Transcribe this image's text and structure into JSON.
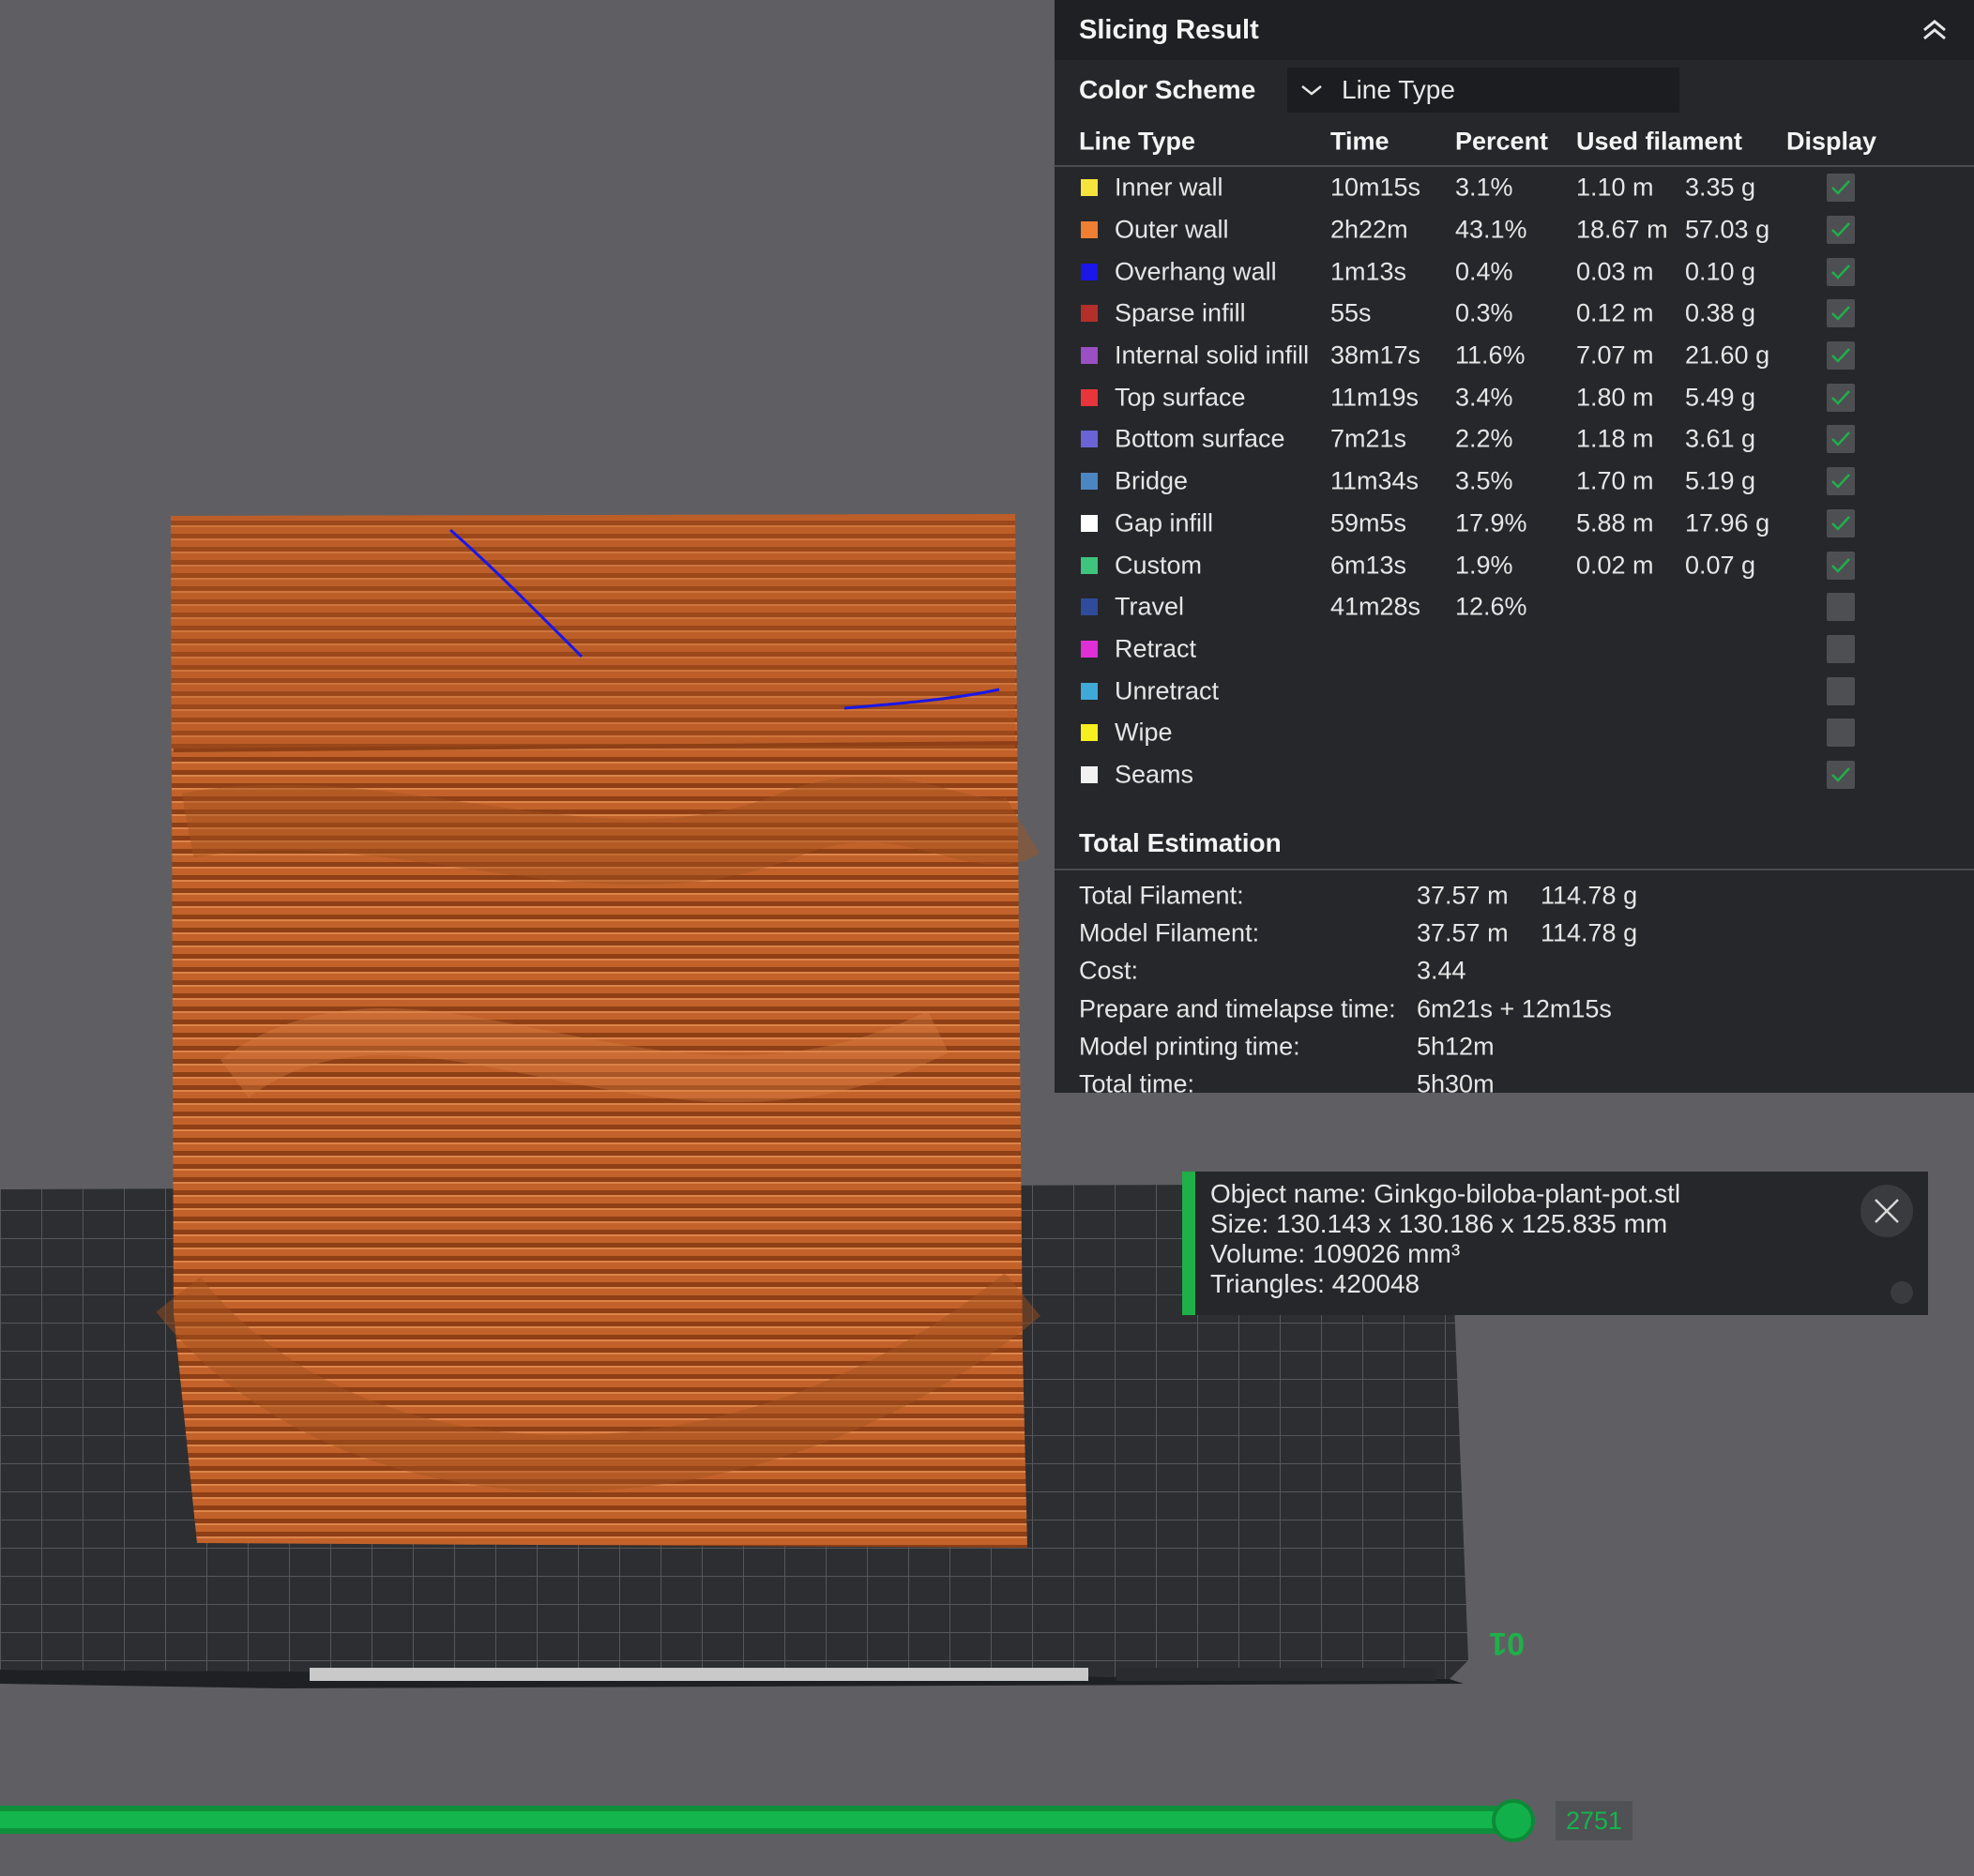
{
  "panel": {
    "title": "Slicing Result",
    "color_scheme_label": "Color Scheme",
    "color_scheme_value": "Line Type",
    "columns": {
      "type": "Line Type",
      "time": "Time",
      "percent": "Percent",
      "used": "Used filament",
      "display": "Display"
    },
    "rows": [
      {
        "name": "Inner wall",
        "color": "#f6e33d",
        "time": "10m15s",
        "percent": "3.1%",
        "length": "1.10 m",
        "weight": "3.35 g",
        "display": true
      },
      {
        "name": "Outer wall",
        "color": "#f07f32",
        "time": "2h22m",
        "percent": "43.1%",
        "length": "18.67 m",
        "weight": "57.03 g",
        "display": true
      },
      {
        "name": "Overhang wall",
        "color": "#1a17e8",
        "time": "1m13s",
        "percent": "0.4%",
        "length": "0.03 m",
        "weight": "0.10 g",
        "display": true
      },
      {
        "name": "Sparse infill",
        "color": "#b52f2a",
        "time": "55s",
        "percent": "0.3%",
        "length": "0.12 m",
        "weight": "0.38 g",
        "display": true
      },
      {
        "name": "Internal solid infill",
        "color": "#9a4fc2",
        "time": "38m17s",
        "percent": "11.6%",
        "length": "7.07 m",
        "weight": "21.60 g",
        "display": true
      },
      {
        "name": "Top surface",
        "color": "#e8353a",
        "time": "11m19s",
        "percent": "3.4%",
        "length": "1.80 m",
        "weight": "5.49 g",
        "display": true
      },
      {
        "name": "Bottom surface",
        "color": "#6a63d6",
        "time": "7m21s",
        "percent": "2.2%",
        "length": "1.18 m",
        "weight": "3.61 g",
        "display": true
      },
      {
        "name": "Bridge",
        "color": "#4c86c2",
        "time": "11m34s",
        "percent": "3.5%",
        "length": "1.70 m",
        "weight": "5.19 g",
        "display": true
      },
      {
        "name": "Gap infill",
        "color": "#ffffff",
        "time": "59m5s",
        "percent": "17.9%",
        "length": "5.88 m",
        "weight": "17.96 g",
        "display": true
      },
      {
        "name": "Custom",
        "color": "#3ec47d",
        "time": "6m13s",
        "percent": "1.9%",
        "length": "0.02 m",
        "weight": "0.07 g",
        "display": true
      },
      {
        "name": "Travel",
        "color": "#2f4c9c",
        "time": "41m28s",
        "percent": "12.6%",
        "length": "",
        "weight": "",
        "display": false
      },
      {
        "name": "Retract",
        "color": "#e02fd6",
        "time": "",
        "percent": "",
        "length": "",
        "weight": "",
        "display": false
      },
      {
        "name": "Unretract",
        "color": "#3fa9d8",
        "time": "",
        "percent": "",
        "length": "",
        "weight": "",
        "display": false
      },
      {
        "name": "Wipe",
        "color": "#f6ee1e",
        "time": "",
        "percent": "",
        "length": "",
        "weight": "",
        "display": false
      },
      {
        "name": "Seams",
        "color": "#f2f2f2",
        "time": "",
        "percent": "",
        "length": "",
        "weight": "",
        "display": true
      }
    ],
    "total_title": "Total Estimation",
    "totals": [
      {
        "label": "Total Filament:",
        "a": "37.57 m",
        "b": "114.78 g"
      },
      {
        "label": "Model Filament:",
        "a": "37.57 m",
        "b": "114.78 g"
      },
      {
        "label": "Cost:",
        "a": "3.44",
        "b": ""
      },
      {
        "label": "Prepare and timelapse time:",
        "a": "6m21s + 12m15s",
        "b": ""
      },
      {
        "label": "Model printing time:",
        "a": "5h12m",
        "b": ""
      },
      {
        "label": "Total time:",
        "a": "5h30m",
        "b": ""
      }
    ]
  },
  "object_info": {
    "name": "Object name: Ginkgo-biloba-plant-pot.stl",
    "size": "Size: 130.143 x 130.186 x 125.835 mm",
    "volume": "Volume: 109026 mm³",
    "triangles": "Triangles: 420048"
  },
  "plate_label": "01",
  "layer_slider": {
    "value": "2751"
  },
  "colors": {
    "accent": "#14b54d",
    "model": "#c8672a",
    "panel": "#26272a",
    "background": "#5f5f63"
  }
}
